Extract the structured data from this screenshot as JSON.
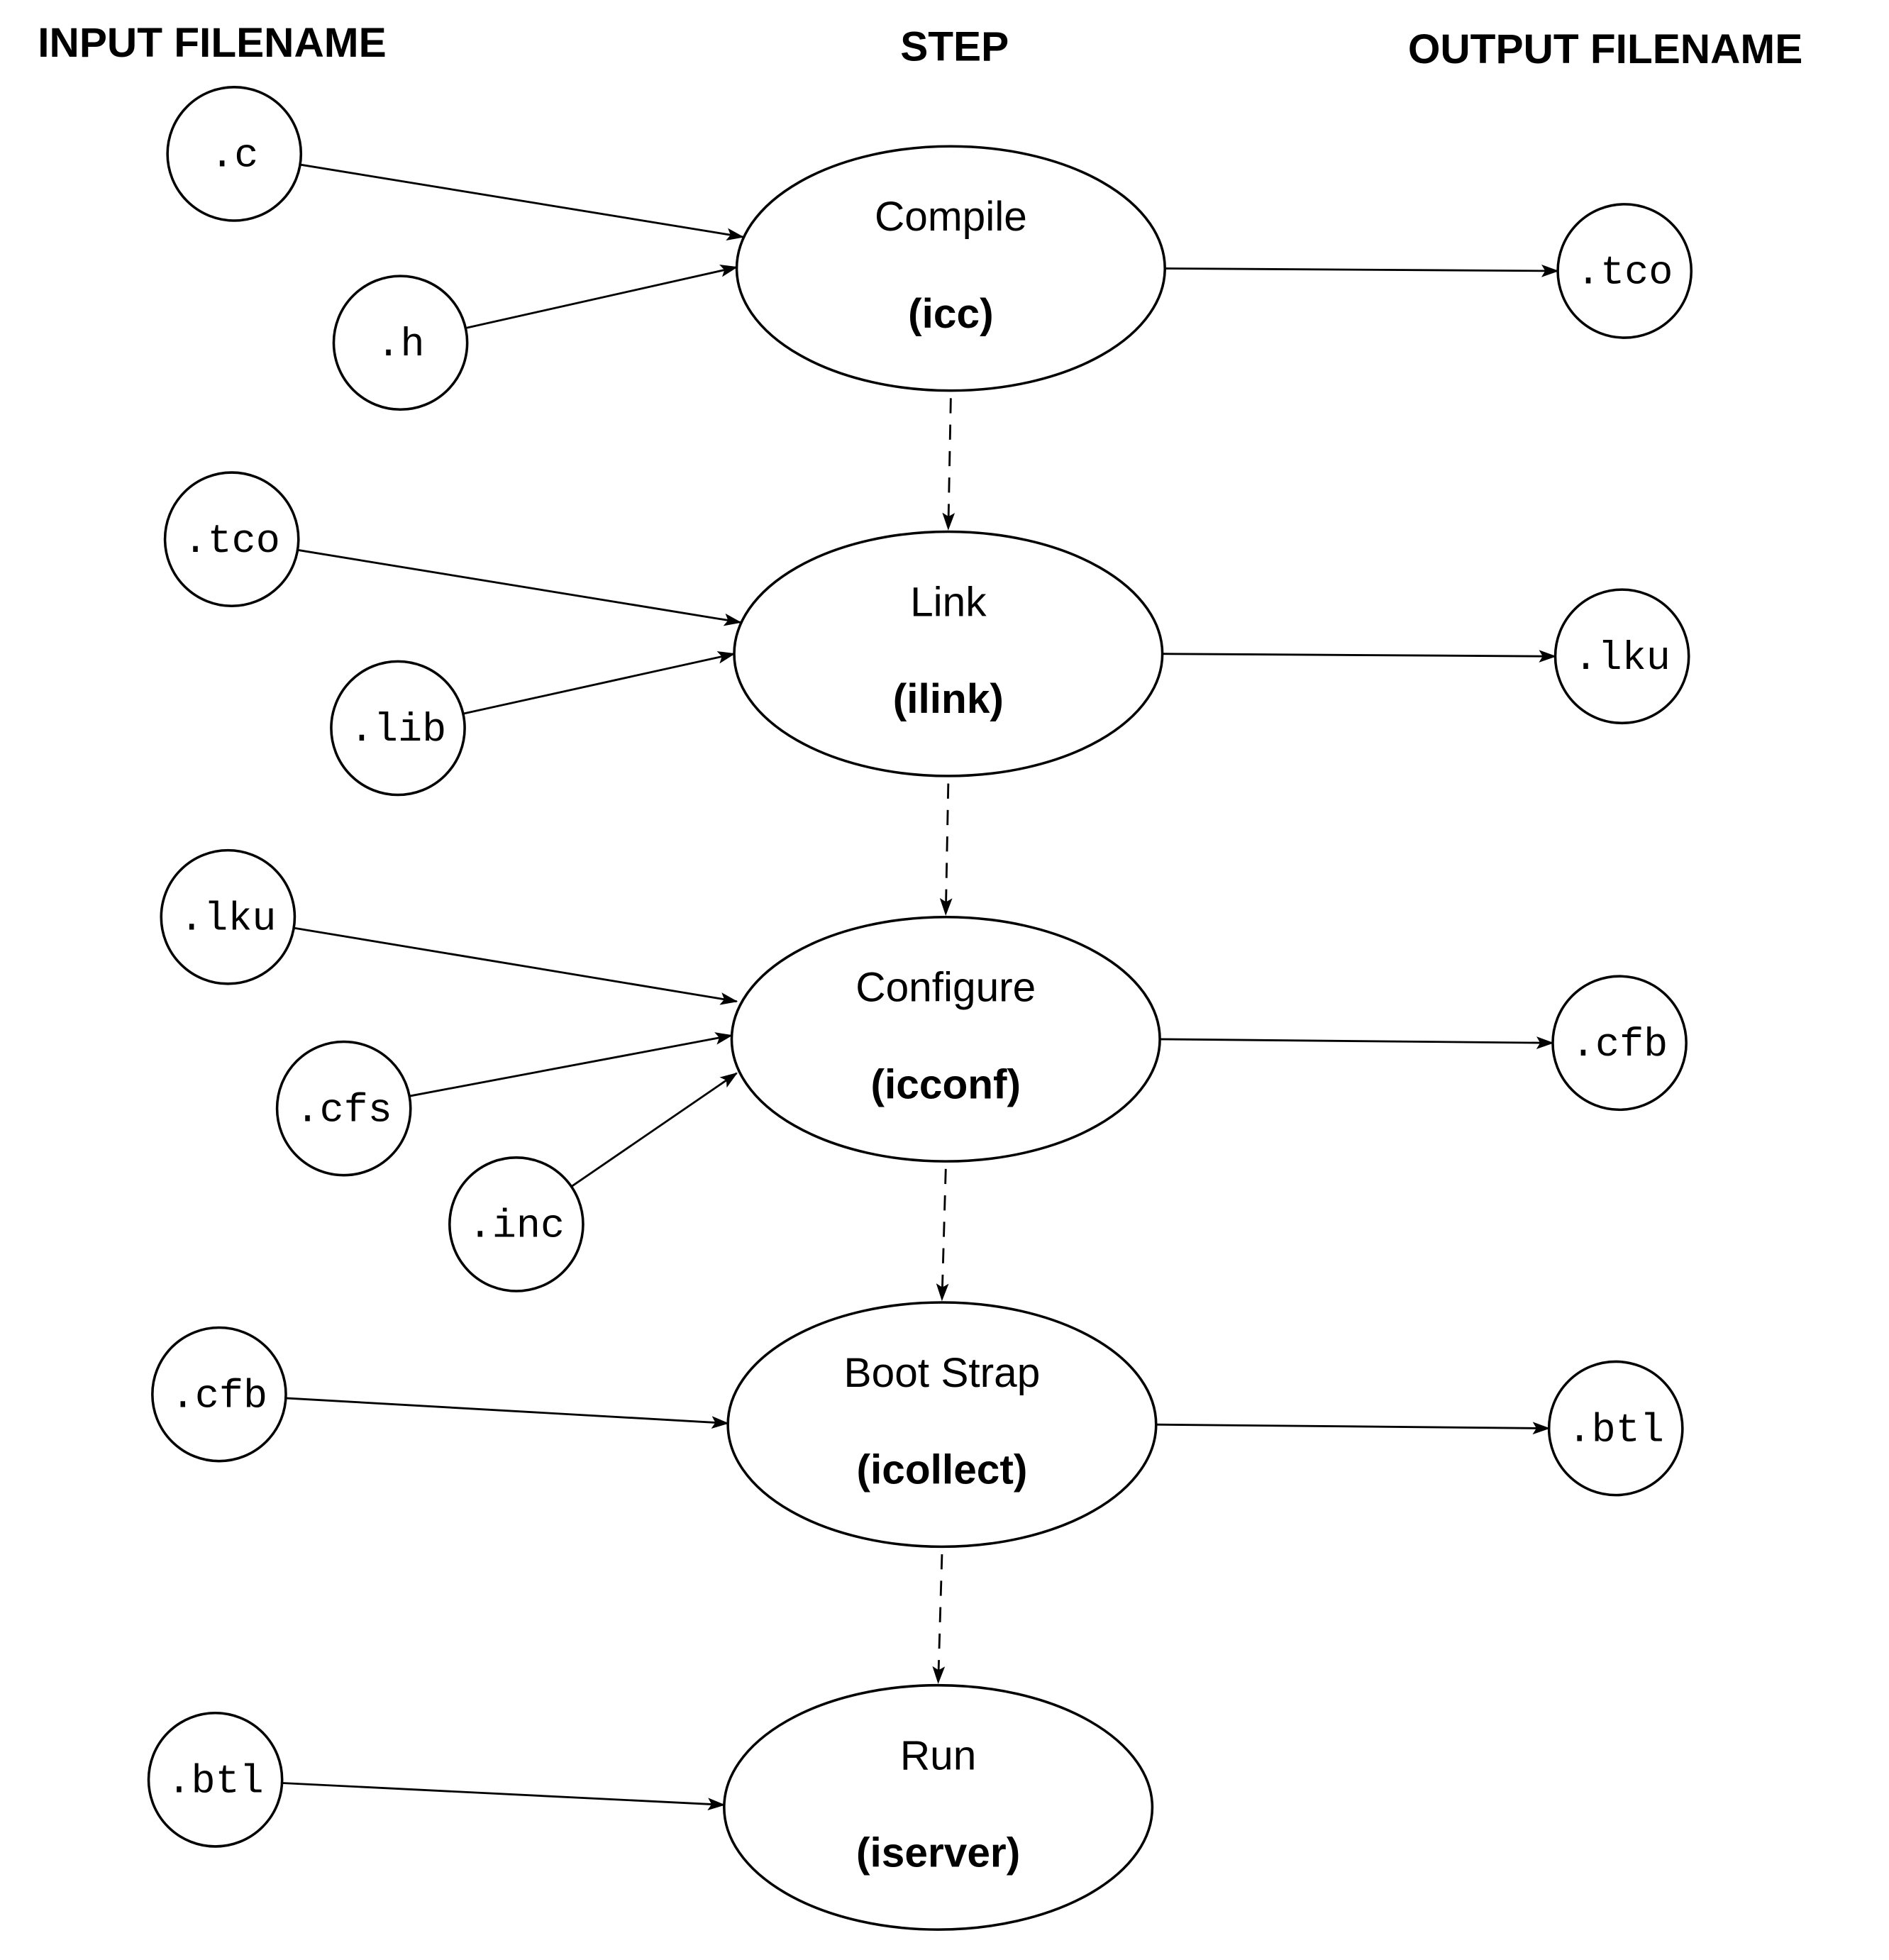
{
  "headers": {
    "input": "INPUT FILENAME",
    "step": "STEP",
    "output": "OUTPUT FILENAME"
  },
  "steps": [
    {
      "name": "Compile",
      "tool": "(icc)",
      "inputs": [
        ".c",
        ".h"
      ],
      "output": ".tco"
    },
    {
      "name": "Link",
      "tool": "(ilink)",
      "inputs": [
        ".tco",
        ".lib"
      ],
      "output": ".lku"
    },
    {
      "name": "Configure",
      "tool": "(icconf)",
      "inputs": [
        ".lku",
        ".cfs",
        ".inc"
      ],
      "output": ".cfb"
    },
    {
      "name": "Boot Strap",
      "tool": "(icollect)",
      "inputs": [
        ".cfb"
      ],
      "output": ".btl"
    },
    {
      "name": "Run",
      "tool": "(iserver)",
      "inputs": [
        ".btl"
      ],
      "output": null
    }
  ]
}
